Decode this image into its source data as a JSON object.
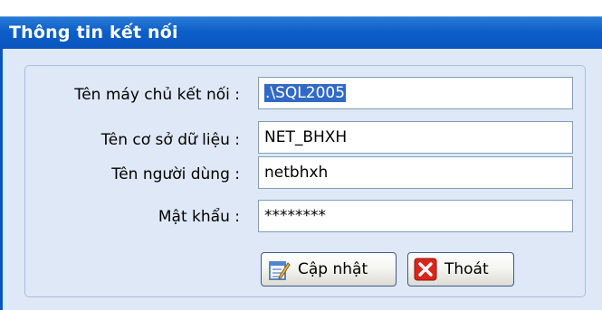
{
  "window": {
    "title": "Thông tin kết nối"
  },
  "form": {
    "server_label": "Tên máy chủ kết nối :",
    "server_value": ".\\SQL2005",
    "database_label": "Tên cơ sở dữ liệu :",
    "database_value": "NET_BHXH",
    "user_label": "Tên người dùng :",
    "user_value": "netbhxh",
    "password_label": "Mật khẩu :",
    "password_value": "********"
  },
  "buttons": {
    "update_label": "Cập nhật",
    "update_icon": "edit-document-icon",
    "exit_label": "Thoát",
    "exit_icon": "close-x-icon"
  },
  "colors": {
    "titlebar": "#0a55bf",
    "client_background": "#dfe8f6",
    "selection": "#316ac5",
    "exit_icon_red": "#d9261c"
  }
}
